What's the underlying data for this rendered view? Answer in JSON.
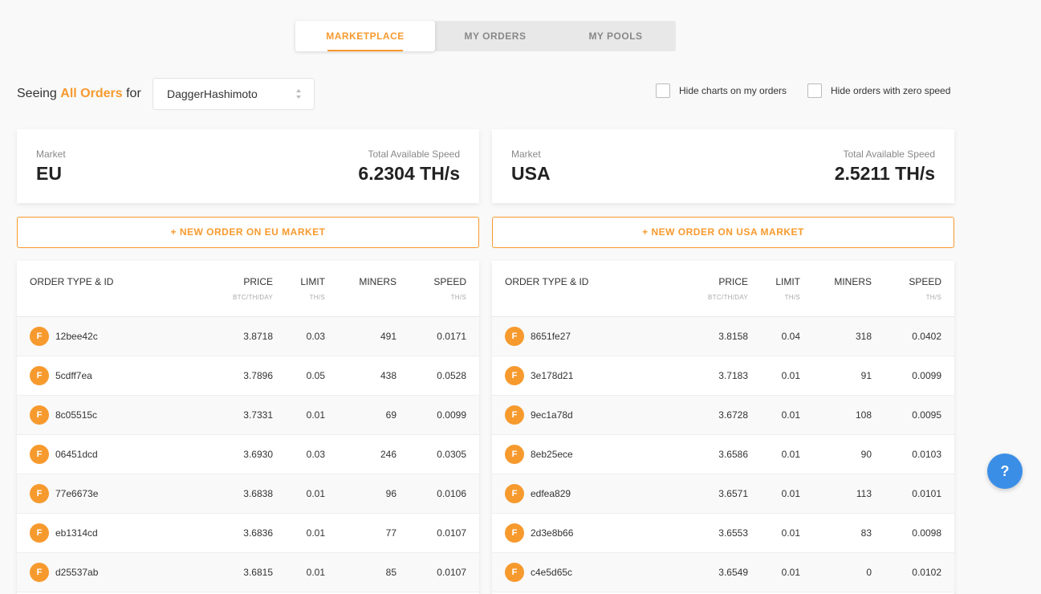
{
  "tabs": [
    {
      "label": "MARKETPLACE"
    },
    {
      "label": "MY ORDERS"
    },
    {
      "label": "MY POOLS"
    }
  ],
  "filter": {
    "prefix": "Seeing",
    "highlight": "All Orders",
    "suffix": "for",
    "algorithm": "DaggerHashimoto"
  },
  "options": {
    "hide_charts": "Hide charts on my orders",
    "hide_zero": "Hide orders with zero speed"
  },
  "markets": [
    {
      "market_label": "Market",
      "name": "EU",
      "speed_label": "Total Available Speed",
      "speed": "6.2304 TH/s",
      "new_order": "+ NEW ORDER ON EU MARKET",
      "headers": {
        "type": "ORDER TYPE & ID",
        "price": "PRICE",
        "price_unit": "BTC/TH/DAY",
        "limit": "LIMIT",
        "limit_unit": "TH/S",
        "miners": "MINERS",
        "speed": "SPEED",
        "speed_unit": "TH/S"
      },
      "rows": [
        {
          "type": "F",
          "id": "12bee42c",
          "price": "3.8718",
          "limit": "0.03",
          "miners": "491",
          "speed": "0.0171"
        },
        {
          "type": "F",
          "id": "5cdff7ea",
          "price": "3.7896",
          "limit": "0.05",
          "miners": "438",
          "speed": "0.0528"
        },
        {
          "type": "F",
          "id": "8c05515c",
          "price": "3.7331",
          "limit": "0.01",
          "miners": "69",
          "speed": "0.0099"
        },
        {
          "type": "F",
          "id": "06451dcd",
          "price": "3.6930",
          "limit": "0.03",
          "miners": "246",
          "speed": "0.0305"
        },
        {
          "type": "F",
          "id": "77e6673e",
          "price": "3.6838",
          "limit": "0.01",
          "miners": "96",
          "speed": "0.0106"
        },
        {
          "type": "F",
          "id": "eb1314cd",
          "price": "3.6836",
          "limit": "0.01",
          "miners": "77",
          "speed": "0.0107"
        },
        {
          "type": "F",
          "id": "d25537ab",
          "price": "3.6815",
          "limit": "0.01",
          "miners": "85",
          "speed": "0.0107"
        }
      ]
    },
    {
      "market_label": "Market",
      "name": "USA",
      "speed_label": "Total Available Speed",
      "speed": "2.5211 TH/s",
      "new_order": "+ NEW ORDER ON USA MARKET",
      "headers": {
        "type": "ORDER TYPE & ID",
        "price": "PRICE",
        "price_unit": "BTC/TH/DAY",
        "limit": "LIMIT",
        "limit_unit": "TH/S",
        "miners": "MINERS",
        "speed": "SPEED",
        "speed_unit": "TH/S"
      },
      "rows": [
        {
          "type": "F",
          "id": "8651fe27",
          "price": "3.8158",
          "limit": "0.04",
          "miners": "318",
          "speed": "0.0402"
        },
        {
          "type": "F",
          "id": "3e178d21",
          "price": "3.7183",
          "limit": "0.01",
          "miners": "91",
          "speed": "0.0099"
        },
        {
          "type": "F",
          "id": "9ec1a78d",
          "price": "3.6728",
          "limit": "0.01",
          "miners": "108",
          "speed": "0.0095"
        },
        {
          "type": "F",
          "id": "8eb25ece",
          "price": "3.6586",
          "limit": "0.01",
          "miners": "90",
          "speed": "0.0103"
        },
        {
          "type": "F",
          "id": "edfea829",
          "price": "3.6571",
          "limit": "0.01",
          "miners": "113",
          "speed": "0.0101"
        },
        {
          "type": "F",
          "id": "2d3e8b66",
          "price": "3.6553",
          "limit": "0.01",
          "miners": "83",
          "speed": "0.0098"
        },
        {
          "type": "F",
          "id": "c4e5d65c",
          "price": "3.6549",
          "limit": "0.01",
          "miners": "0",
          "speed": "0.0102"
        }
      ]
    }
  ],
  "help": {
    "label": "?"
  },
  "colors": {
    "accent": "#f79a2e",
    "help_button": "#3a8ee6"
  }
}
